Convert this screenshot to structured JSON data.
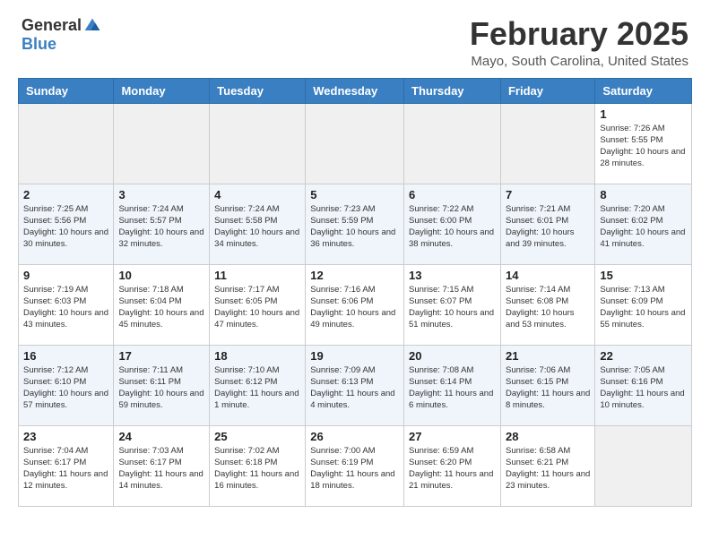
{
  "header": {
    "logo": {
      "general": "General",
      "blue": "Blue"
    },
    "month": "February 2025",
    "location": "Mayo, South Carolina, United States"
  },
  "weekdays": [
    "Sunday",
    "Monday",
    "Tuesday",
    "Wednesday",
    "Thursday",
    "Friday",
    "Saturday"
  ],
  "weeks": [
    [
      {
        "day": "",
        "info": ""
      },
      {
        "day": "",
        "info": ""
      },
      {
        "day": "",
        "info": ""
      },
      {
        "day": "",
        "info": ""
      },
      {
        "day": "",
        "info": ""
      },
      {
        "day": "",
        "info": ""
      },
      {
        "day": "1",
        "info": "Sunrise: 7:26 AM\nSunset: 5:55 PM\nDaylight: 10 hours and 28 minutes."
      }
    ],
    [
      {
        "day": "2",
        "info": "Sunrise: 7:25 AM\nSunset: 5:56 PM\nDaylight: 10 hours and 30 minutes."
      },
      {
        "day": "3",
        "info": "Sunrise: 7:24 AM\nSunset: 5:57 PM\nDaylight: 10 hours and 32 minutes."
      },
      {
        "day": "4",
        "info": "Sunrise: 7:24 AM\nSunset: 5:58 PM\nDaylight: 10 hours and 34 minutes."
      },
      {
        "day": "5",
        "info": "Sunrise: 7:23 AM\nSunset: 5:59 PM\nDaylight: 10 hours and 36 minutes."
      },
      {
        "day": "6",
        "info": "Sunrise: 7:22 AM\nSunset: 6:00 PM\nDaylight: 10 hours and 38 minutes."
      },
      {
        "day": "7",
        "info": "Sunrise: 7:21 AM\nSunset: 6:01 PM\nDaylight: 10 hours and 39 minutes."
      },
      {
        "day": "8",
        "info": "Sunrise: 7:20 AM\nSunset: 6:02 PM\nDaylight: 10 hours and 41 minutes."
      }
    ],
    [
      {
        "day": "9",
        "info": "Sunrise: 7:19 AM\nSunset: 6:03 PM\nDaylight: 10 hours and 43 minutes."
      },
      {
        "day": "10",
        "info": "Sunrise: 7:18 AM\nSunset: 6:04 PM\nDaylight: 10 hours and 45 minutes."
      },
      {
        "day": "11",
        "info": "Sunrise: 7:17 AM\nSunset: 6:05 PM\nDaylight: 10 hours and 47 minutes."
      },
      {
        "day": "12",
        "info": "Sunrise: 7:16 AM\nSunset: 6:06 PM\nDaylight: 10 hours and 49 minutes."
      },
      {
        "day": "13",
        "info": "Sunrise: 7:15 AM\nSunset: 6:07 PM\nDaylight: 10 hours and 51 minutes."
      },
      {
        "day": "14",
        "info": "Sunrise: 7:14 AM\nSunset: 6:08 PM\nDaylight: 10 hours and 53 minutes."
      },
      {
        "day": "15",
        "info": "Sunrise: 7:13 AM\nSunset: 6:09 PM\nDaylight: 10 hours and 55 minutes."
      }
    ],
    [
      {
        "day": "16",
        "info": "Sunrise: 7:12 AM\nSunset: 6:10 PM\nDaylight: 10 hours and 57 minutes."
      },
      {
        "day": "17",
        "info": "Sunrise: 7:11 AM\nSunset: 6:11 PM\nDaylight: 10 hours and 59 minutes."
      },
      {
        "day": "18",
        "info": "Sunrise: 7:10 AM\nSunset: 6:12 PM\nDaylight: 11 hours and 1 minute."
      },
      {
        "day": "19",
        "info": "Sunrise: 7:09 AM\nSunset: 6:13 PM\nDaylight: 11 hours and 4 minutes."
      },
      {
        "day": "20",
        "info": "Sunrise: 7:08 AM\nSunset: 6:14 PM\nDaylight: 11 hours and 6 minutes."
      },
      {
        "day": "21",
        "info": "Sunrise: 7:06 AM\nSunset: 6:15 PM\nDaylight: 11 hours and 8 minutes."
      },
      {
        "day": "22",
        "info": "Sunrise: 7:05 AM\nSunset: 6:16 PM\nDaylight: 11 hours and 10 minutes."
      }
    ],
    [
      {
        "day": "23",
        "info": "Sunrise: 7:04 AM\nSunset: 6:17 PM\nDaylight: 11 hours and 12 minutes."
      },
      {
        "day": "24",
        "info": "Sunrise: 7:03 AM\nSunset: 6:17 PM\nDaylight: 11 hours and 14 minutes."
      },
      {
        "day": "25",
        "info": "Sunrise: 7:02 AM\nSunset: 6:18 PM\nDaylight: 11 hours and 16 minutes."
      },
      {
        "day": "26",
        "info": "Sunrise: 7:00 AM\nSunset: 6:19 PM\nDaylight: 11 hours and 18 minutes."
      },
      {
        "day": "27",
        "info": "Sunrise: 6:59 AM\nSunset: 6:20 PM\nDaylight: 11 hours and 21 minutes."
      },
      {
        "day": "28",
        "info": "Sunrise: 6:58 AM\nSunset: 6:21 PM\nDaylight: 11 hours and 23 minutes."
      },
      {
        "day": "",
        "info": ""
      }
    ]
  ]
}
